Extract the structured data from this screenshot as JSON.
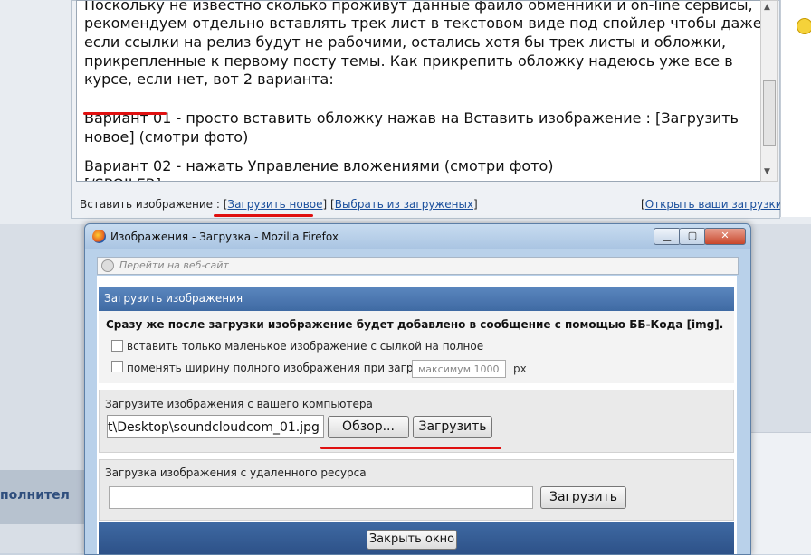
{
  "editor": {
    "lines": [
      "Поскольку не известно сколько проживут данные файло обменники и on-line сервисы,",
      "рекомендуем отдельно вставлять трек лист в текстовом виде под спойлер чтобы даже",
      "если ссылки на релиз будут не рабочими, остались хотя бы трек листы и обложки,",
      "прикрепленные к первому посту темы. Как прикрепить обложку надеюсь уже все в",
      "курсе, если нет, вот 2 варианта:"
    ],
    "variant1_line1": "Вариант 01 - просто вставить обложку нажав на Вставить изображение : [Загрузить",
    "variant1_line2": "новое]  (смотри фото)",
    "variant2": "Вариант 02 - нажать Управление вложениями (смотри фото)",
    "spoiler_close": "[/SPOILER]"
  },
  "insert_bar": {
    "label": "Вставить изображение :",
    "upload_new": "Загрузить новое",
    "choose_uploaded": "Выбрать из загруженых",
    "open_uploads": "Открыть ваши загрузки"
  },
  "background": {
    "side_text": "полнител"
  },
  "popup": {
    "title": "Изображения - Загрузка - Mozilla Firefox",
    "url_placeholder": "Перейти на веб-сайт",
    "section_title": "Загрузить изображения",
    "notice": "Сразу же после загрузки изображение будет добавлено в сообщение с помощью ББ-Кода [img].",
    "checkbox1": "вставить только маленькое изображение с сылкой на полное",
    "checkbox2": "поменять ширину полного изображения при загрузке:",
    "max_width_placeholder": "максимум 1000",
    "px": "px",
    "local_label": "Загрузите изображения с вашего компьютера",
    "file_value": "t\\Desktop\\soundcloudcom_01.jpg",
    "browse_button": "Обзор...",
    "upload_button": "Загрузить",
    "remote_label": "Загрузка изображения с удаленного ресурса",
    "remote_upload_button": "Загрузить",
    "close_button": "Закрыть окно"
  },
  "colors": {
    "accent_red": "#e01010",
    "header_blue": "#3f6aa3",
    "link_blue": "#1a4f9c"
  }
}
